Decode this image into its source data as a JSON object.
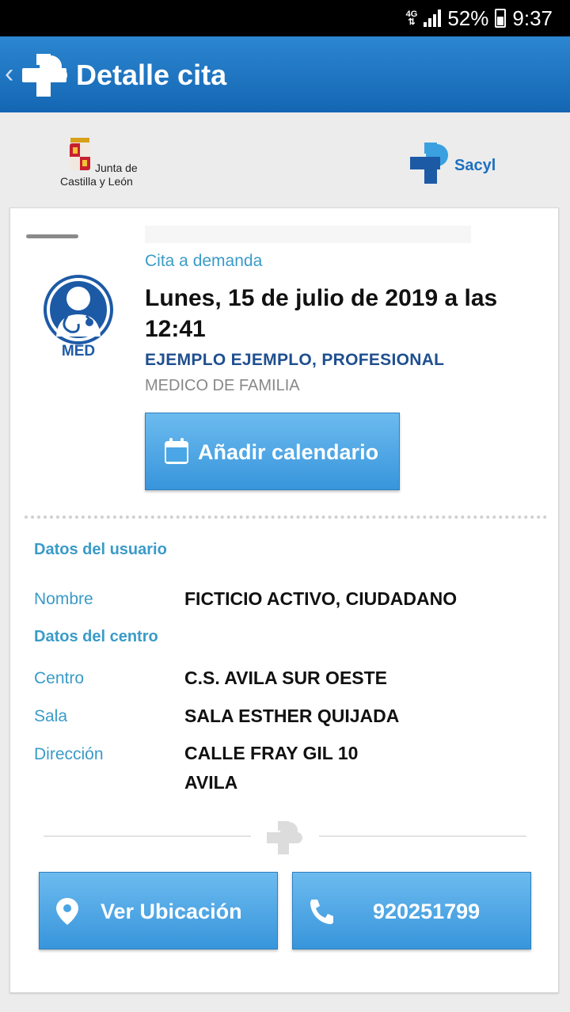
{
  "status_bar": {
    "network": "4G",
    "battery": "52%",
    "time": "9:37"
  },
  "app_bar": {
    "title": "Detalle cita"
  },
  "logos": {
    "junta_line1": "Junta de",
    "junta_line2": "Castilla y León",
    "sacyl": "Sacyl"
  },
  "appointment": {
    "type": "Cita a demanda",
    "date": "Lunes, 15 de julio de 2019 a las 12:41",
    "professional": "EJEMPLO EJEMPLO, PROFESIONAL",
    "specialty": "MEDICO DE FAMILIA",
    "avatar_label": "MED",
    "add_calendar_label": "Añadir calendario"
  },
  "user_data": {
    "section_title": "Datos del usuario",
    "name_label": "Nombre",
    "name_value": "FICTICIO ACTIVO, CIUDADANO"
  },
  "center_data": {
    "section_title": "Datos del centro",
    "center_label": "Centro",
    "center_value": "C.S. AVILA SUR OESTE",
    "room_label": "Sala",
    "room_value": "SALA ESTHER QUIJADA",
    "address_label": "Dirección",
    "address_line1": "CALLE FRAY GIL 10",
    "address_line2": "AVILA"
  },
  "actions": {
    "location_label": "Ver Ubicación",
    "phone_label": "920251799"
  },
  "colors": {
    "primary": "#1d6fc0",
    "accent": "#3a9bc8",
    "button": "#4aa6e4"
  },
  "icons": [
    "back-chevron-icon",
    "sacyl-cross-icon",
    "calendar-icon",
    "location-pin-icon",
    "phone-icon",
    "doctor-icon"
  ]
}
